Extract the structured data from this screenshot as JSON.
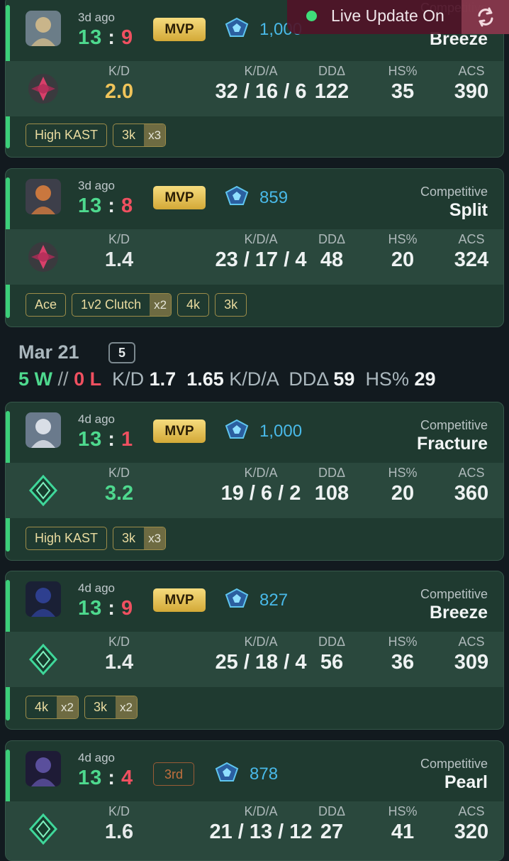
{
  "live": {
    "label": "Live Update On"
  },
  "matches": [
    {
      "ago": "3d ago",
      "won": "13",
      "sep": ":",
      "lost": "9",
      "badge_type": "mvp",
      "badge": "MVP",
      "rr": "1,000",
      "mode": "Competitive",
      "map": "Breeze",
      "kd_label": "K/D",
      "kd": "2.0",
      "kd_color": "#f0c45a",
      "kda_label": "K/D/A",
      "kda": "32 / 16 / 6",
      "dd_label": "DDΔ",
      "dd": "122",
      "hs_label": "HS%",
      "hs": "35",
      "acs_label": "ACS",
      "acs": "390",
      "achievements": [
        {
          "text": "High KAST",
          "mult": ""
        },
        {
          "text": "3k",
          "mult": "x3"
        }
      ],
      "rank": "pink",
      "agent": "blonde"
    },
    {
      "ago": "3d ago",
      "won": "13",
      "sep": ":",
      "lost": "8",
      "badge_type": "mvp",
      "badge": "MVP",
      "rr": "859",
      "mode": "Competitive",
      "map": "Split",
      "kd_label": "K/D",
      "kd": "1.4",
      "kd_color": "#e6eaea",
      "kda_label": "K/D/A",
      "kda": "23 / 17 / 4",
      "dd_label": "DDΔ",
      "dd": "48",
      "hs_label": "HS%",
      "hs": "20",
      "acs_label": "ACS",
      "acs": "324",
      "achievements": [
        {
          "text": "Ace",
          "mult": ""
        },
        {
          "text": "1v2 Clutch",
          "mult": "x2"
        },
        {
          "text": "4k",
          "mult": ""
        },
        {
          "text": "3k",
          "mult": ""
        }
      ],
      "rank": "pink",
      "agent": "orange"
    },
    {
      "ago": "4d ago",
      "won": "13",
      "sep": ":",
      "lost": "1",
      "badge_type": "mvp",
      "badge": "MVP",
      "rr": "1,000",
      "mode": "Competitive",
      "map": "Fracture",
      "kd_label": "K/D",
      "kd": "3.2",
      "kd_color": "#4ed98e",
      "kda_label": "K/D/A",
      "kda": "19 / 6 / 2",
      "dd_label": "DDΔ",
      "dd": "108",
      "hs_label": "HS%",
      "hs": "20",
      "acs_label": "ACS",
      "acs": "360",
      "achievements": [
        {
          "text": "High KAST",
          "mult": ""
        },
        {
          "text": "3k",
          "mult": "x3"
        }
      ],
      "rank": "green",
      "agent": "white"
    },
    {
      "ago": "4d ago",
      "won": "13",
      "sep": ":",
      "lost": "9",
      "badge_type": "mvp",
      "badge": "MVP",
      "rr": "827",
      "mode": "Competitive",
      "map": "Breeze",
      "kd_label": "K/D",
      "kd": "1.4",
      "kd_color": "#e6eaea",
      "kda_label": "K/D/A",
      "kda": "25 / 18 / 4",
      "dd_label": "DDΔ",
      "dd": "56",
      "hs_label": "HS%",
      "hs": "36",
      "acs_label": "ACS",
      "acs": "309",
      "achievements": [
        {
          "text": "4k",
          "mult": "x2"
        },
        {
          "text": "3k",
          "mult": "x2"
        }
      ],
      "rank": "green",
      "agent": "blue"
    },
    {
      "ago": "4d ago",
      "won": "13",
      "sep": ":",
      "lost": "4",
      "badge_type": "third",
      "badge": "3rd",
      "rr": "878",
      "mode": "Competitive",
      "map": "Pearl",
      "kd_label": "K/D",
      "kd": "1.6",
      "kd_color": "#e6eaea",
      "kda_label": "K/D/A",
      "kda": "21 / 13 / 12",
      "dd_label": "DDΔ",
      "dd": "27",
      "hs_label": "HS%",
      "hs": "41",
      "acs_label": "ACS",
      "acs": "320",
      "achievements": [],
      "rank": "green",
      "agent": "purple"
    }
  ],
  "day": {
    "date": "Mar 21",
    "count": "5",
    "wins": "5 W",
    "sep": "//",
    "losses": "0 L",
    "kd_label": "K/D",
    "kd": "1.7",
    "kda": "1.65",
    "kda_label": "K/D/A",
    "dd_label": "DDΔ",
    "dd": "59",
    "hs_label": "HS%",
    "hs": "29"
  }
}
